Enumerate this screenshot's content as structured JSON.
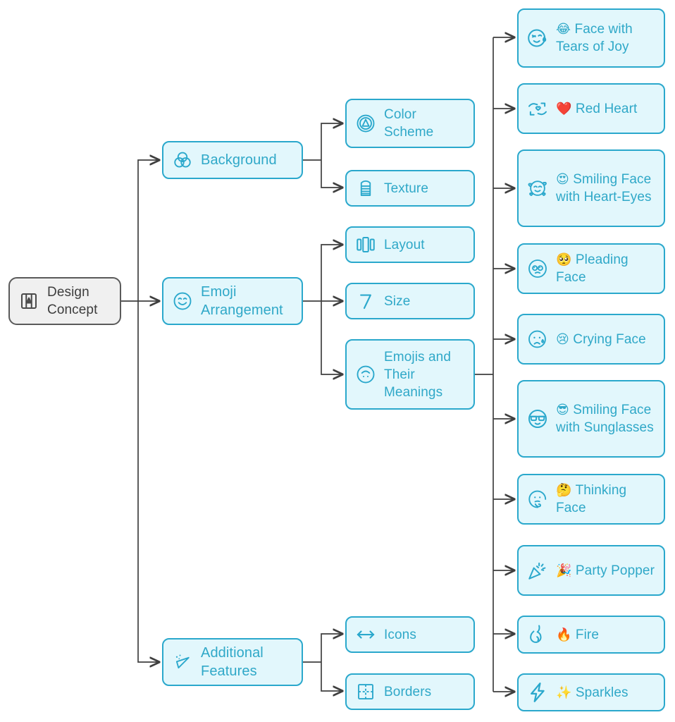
{
  "diagram": {
    "title": "Design Concept",
    "type": "mindmap",
    "colors": {
      "node_border": "#2aa8cc",
      "node_fill": "#e2f7fc",
      "node_text": "#2fa8c8",
      "root_border": "#5a5a5a",
      "root_fill": "#f0f0f0",
      "root_text": "#3d3d3d",
      "edge": "#4a4a4a",
      "background": "#ffffff"
    }
  },
  "root": {
    "label": "Design Concept",
    "icon": "pencil-sharpener-icon"
  },
  "branches": [
    {
      "label": "Background",
      "icon": "venn-circles-icon"
    },
    {
      "label": "Emoji Arrangement",
      "icon": "smiley-face-icon"
    },
    {
      "label": "Additional Features",
      "icon": "magic-wand-icon"
    }
  ],
  "subnodes": [
    {
      "label": "Color Scheme",
      "icon": "color-palette-circle-icon"
    },
    {
      "label": "Texture",
      "icon": "fabric-vest-icon"
    },
    {
      "label": "Layout",
      "icon": "columns-layout-icon"
    },
    {
      "label": "Size",
      "icon": "number-seven-icon"
    },
    {
      "label": "Emojis and Their Meanings",
      "icon": "face-outline-icon"
    },
    {
      "label": "Icons",
      "icon": "double-arrow-icon"
    },
    {
      "label": "Borders",
      "icon": "dashed-border-box-icon"
    }
  ],
  "leaves": [
    {
      "emoji": "😂",
      "label": "Face with Tears of Joy",
      "icon": "crying-laughing-face-outline-icon"
    },
    {
      "emoji": "❤️",
      "label": "Red Heart",
      "icon": "heart-in-hands-icon"
    },
    {
      "emoji": "😍",
      "label": "Smiling Face with Heart-Eyes",
      "icon": "face-with-hearts-outline-icon"
    },
    {
      "emoji": "🥺",
      "label": "Pleading Face",
      "icon": "pleading-face-outline-icon"
    },
    {
      "emoji": "😢",
      "label": "Crying Face",
      "icon": "crying-face-outline-icon"
    },
    {
      "emoji": "😎",
      "label": "Smiling Face with Sunglasses",
      "icon": "sunglasses-face-outline-icon"
    },
    {
      "emoji": "🤔",
      "label": "Thinking Face",
      "icon": "thinking-face-outline-icon"
    },
    {
      "emoji": "🎉",
      "label": "Party Popper",
      "icon": "party-popper-outline-icon"
    },
    {
      "emoji": "🔥",
      "label": "Fire",
      "icon": "flame-outline-icon"
    },
    {
      "emoji": "✨",
      "label": "Sparkles",
      "icon": "lightning-bolt-outline-icon"
    }
  ]
}
